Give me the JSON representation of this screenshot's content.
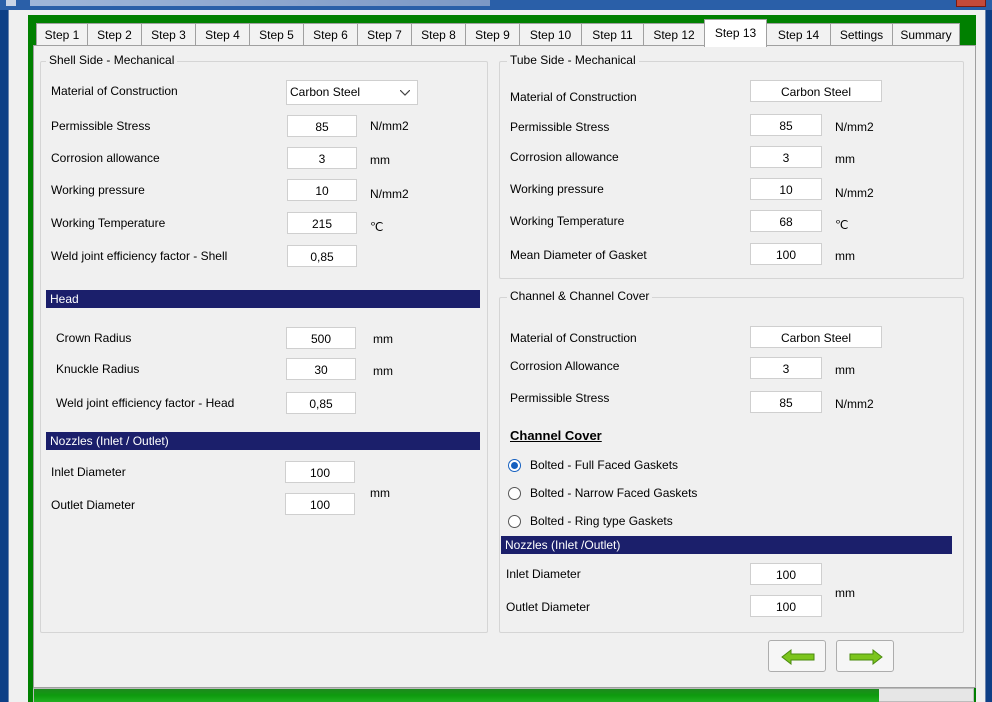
{
  "tabs": [
    "Step 1",
    "Step 2",
    "Step 3",
    "Step 4",
    "Step 5",
    "Step 6",
    "Step 7",
    "Step 8",
    "Step 9",
    "Step 10",
    "Step 11",
    "Step 12",
    "Step 13",
    "Step 14",
    "Settings",
    "Summary"
  ],
  "active_tab": "Step 13",
  "shell": {
    "title": "Shell Side - Mechanical",
    "material_label": "Material of Construction",
    "material_value": "Carbon Steel",
    "stress_label": "Permissible Stress",
    "stress_value": "85",
    "stress_unit": "N/mm2",
    "corrosion_label": "Corrosion allowance",
    "corrosion_value": "3",
    "corrosion_unit": "mm",
    "pressure_label": "Working pressure",
    "pressure_value": "10",
    "pressure_unit": "N/mm2",
    "temp_label": "Working Temperature",
    "temp_value": "215",
    "temp_unit": "℃",
    "weld_label": "Weld joint efficiency factor - Shell",
    "weld_value": "0,85"
  },
  "head": {
    "title": "Head",
    "crown_label": "Crown Radius",
    "crown_value": "500",
    "crown_unit": "mm",
    "knuckle_label": "Knuckle Radius",
    "knuckle_value": "30",
    "knuckle_unit": "mm",
    "weld_label": "Weld joint efficiency factor - Head",
    "weld_value": "0,85"
  },
  "nozzles_left": {
    "title": "Nozzles (Inlet / Outlet)",
    "inlet_label": "Inlet Diameter",
    "inlet_value": "100",
    "outlet_label": "Outlet Diameter",
    "outlet_value": "100",
    "unit": "mm"
  },
  "tube": {
    "title": "Tube Side - Mechanical",
    "material_label": "Material of Construction",
    "material_value": "Carbon Steel",
    "stress_label": "Permissible Stress",
    "stress_value": "85",
    "stress_unit": "N/mm2",
    "corrosion_label": "Corrosion allowance",
    "corrosion_value": "3",
    "corrosion_unit": "mm",
    "pressure_label": "Working pressure",
    "pressure_value": "10",
    "pressure_unit": "N/mm2",
    "temp_label": "Working Temperature",
    "temp_value": "68",
    "temp_unit": "℃",
    "gasket_label": "Mean Diameter of Gasket",
    "gasket_value": "100",
    "gasket_unit": "mm"
  },
  "channel": {
    "title": "Channel & Channel Cover",
    "material_label": "Material of Construction",
    "material_value": "Carbon Steel",
    "corrosion_label": "Corrosion Allowance",
    "corrosion_value": "3",
    "corrosion_unit": "mm",
    "stress_label": "Permissible Stress",
    "stress_value": "85",
    "stress_unit": "N/mm2",
    "cover_title": "Channel Cover",
    "options": [
      "Bolted - Full Faced Gaskets",
      "Bolted - Narrow Faced Gaskets",
      "Bolted - Ring type Gaskets"
    ],
    "selected_option": "Bolted - Full Faced Gaskets"
  },
  "nozzles_right": {
    "title": "Nozzles (Inlet /Outlet)",
    "inlet_label": "Inlet Diameter",
    "inlet_value": "100",
    "outlet_label": "Outlet Diameter",
    "outlet_value": "100",
    "unit": "mm"
  },
  "progress": 0.9,
  "colors": {
    "section_bar": "#1b1f6b",
    "window_bg": "#008000",
    "arrow": "#7cc51d"
  }
}
